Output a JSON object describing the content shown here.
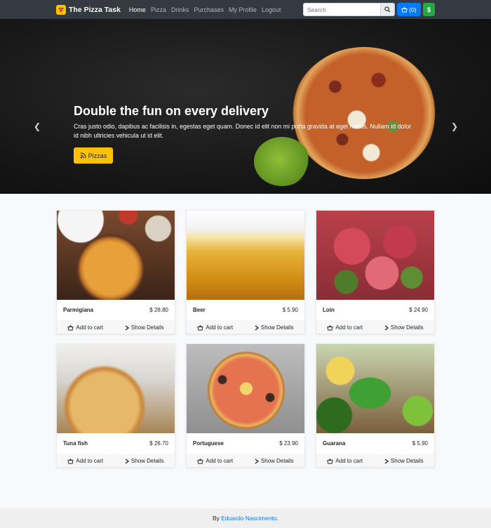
{
  "navbar": {
    "brand": "The Pizza Task",
    "links": [
      {
        "label": "Home",
        "active": true
      },
      {
        "label": "Pizza",
        "active": false
      },
      {
        "label": "Drinks",
        "active": false
      },
      {
        "label": "Purchases",
        "active": false
      },
      {
        "label": "My Profile",
        "active": false
      },
      {
        "label": "Logout",
        "active": false
      }
    ],
    "search_placeholder": "Search",
    "cart_count": "(0)",
    "currency_label": "$"
  },
  "hero": {
    "title": "Double the fun on every delivery",
    "text": "Cras justo odio, dapibus ac facilisis in, egestas eget quam. Donec id elit non mi porta gravida at eget metus. Nullam id dolor id nibh ultricies vehicula ut id elit.",
    "button_label": "Pizzas"
  },
  "products": [
    {
      "name": "Parmigiana",
      "price": "$ 28.80",
      "image": "img-parmigiana"
    },
    {
      "name": "Beer",
      "price": "$ 5.90",
      "image": "img-beer"
    },
    {
      "name": "Loin",
      "price": "$ 24.90",
      "image": "img-loin"
    },
    {
      "name": "Tuna fish",
      "price": "$ 26.70",
      "image": "img-tuna"
    },
    {
      "name": "Portuguese",
      "price": "$ 23.90",
      "image": "img-portuguese"
    },
    {
      "name": "Guarana",
      "price": "$ 5.90",
      "image": "img-guarana"
    }
  ],
  "card_actions": {
    "add_to_cart": "Add to cart",
    "show_details": "Show Details"
  },
  "footer": {
    "prefix": "By ",
    "author": "Eduardo Nascimento",
    "suffix": "."
  },
  "colors": {
    "navbar_bg": "#343a40",
    "primary": "#007bff",
    "success": "#28a745",
    "warning": "#ffc107"
  },
  "icons": [
    "pizza-logo-icon",
    "search-icon",
    "basket-icon",
    "rss-icon",
    "chevron-left-icon",
    "chevron-right-icon",
    "chevron-right-small-icon"
  ]
}
